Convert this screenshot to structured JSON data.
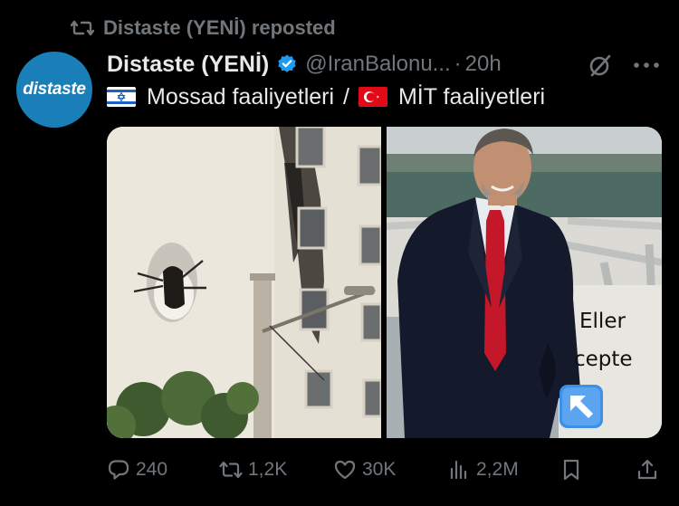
{
  "repost": {
    "label": "Distaste (YENİ) reposted",
    "icon": "repost-icon"
  },
  "author": {
    "avatar_text": "distaste",
    "name": "Distaste (YENİ)",
    "verified_icon": "verified-badge-icon",
    "handle": "@IranBalonu...",
    "separator": "·",
    "time": "20h"
  },
  "tweet": {
    "left_flag": "israel-flag-icon",
    "left_text": "Mossad faaliyetleri",
    "divider": "/",
    "right_flag": "turkey-flag-icon",
    "right_text": "MİT faaliyetleri"
  },
  "media": {
    "left_image": "damaged-apartment-building-photo",
    "right_image": "smiling-man-in-suit-photo",
    "caption_line1": "Eller",
    "caption_line2": "cepte",
    "arrow_icon": "up-left-arrow-emoji"
  },
  "actions": {
    "replies": "240",
    "reposts": "1,2K",
    "likes": "30K",
    "views": "2,2M"
  },
  "colors": {
    "background": "#000000",
    "text": "#e7e9ea",
    "muted": "#71767b",
    "verified": "#1d9bf0",
    "avatar": "#1a7fb8"
  }
}
